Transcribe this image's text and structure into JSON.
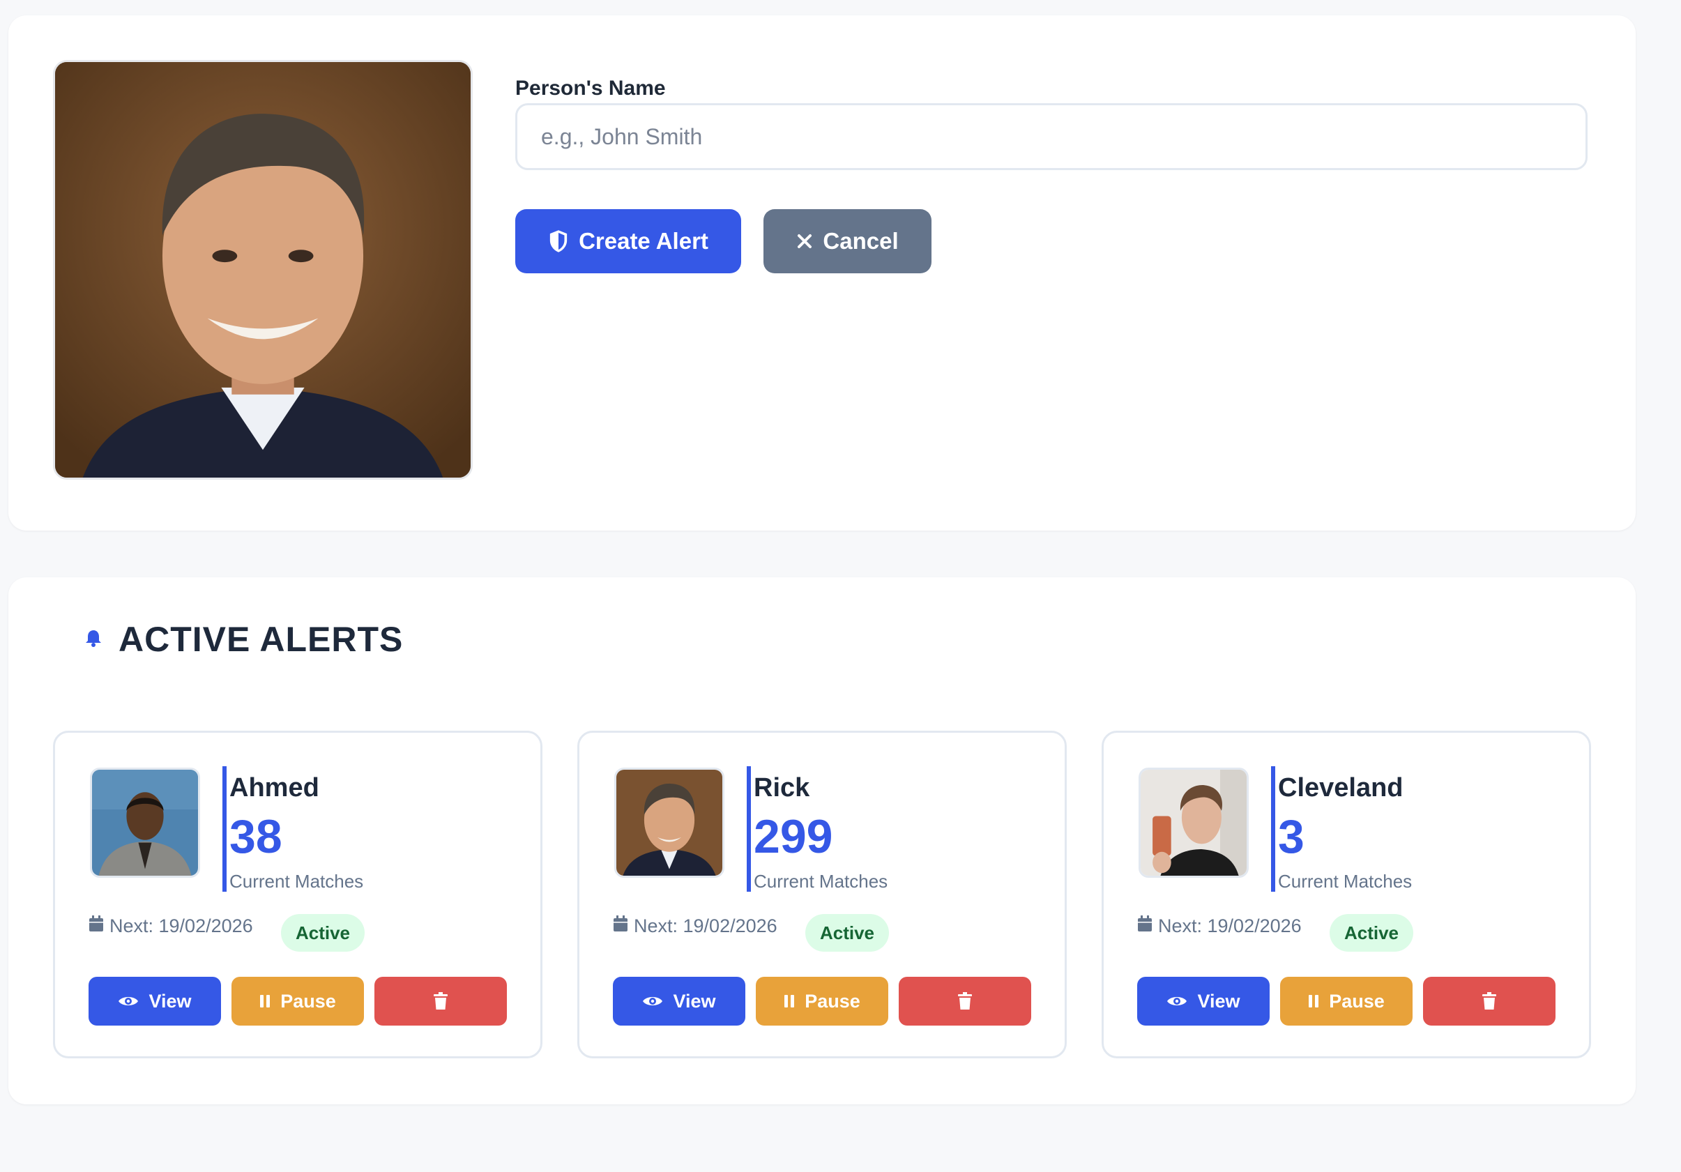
{
  "create_form": {
    "name_label": "Person's Name",
    "name_value": "",
    "name_placeholder": "e.g., John Smith",
    "create_label": "Create Alert",
    "cancel_label": "Cancel"
  },
  "alerts_section": {
    "title": "ACTIVE ALERTS",
    "icon": "bell-icon",
    "alerts": [
      {
        "name": "Ahmed",
        "count": "38",
        "count_label": "Current Matches",
        "next": "Next: 19/02/2026",
        "status": "Active",
        "view_label": "View",
        "pause_label": "Pause"
      },
      {
        "name": "Rick",
        "count": "299",
        "count_label": "Current Matches",
        "next": "Next: 19/02/2026",
        "status": "Active",
        "view_label": "View",
        "pause_label": "Pause"
      },
      {
        "name": "Cleveland",
        "count": "3",
        "count_label": "Current Matches",
        "next": "Next: 19/02/2026",
        "status": "Active",
        "view_label": "View",
        "pause_label": "Pause"
      }
    ]
  },
  "colors": {
    "primary": "#3558e6",
    "secondary": "#64748b",
    "warning": "#e8a23a",
    "danger": "#e0524f",
    "success_bg": "#dcfce7",
    "success_text": "#166534"
  }
}
